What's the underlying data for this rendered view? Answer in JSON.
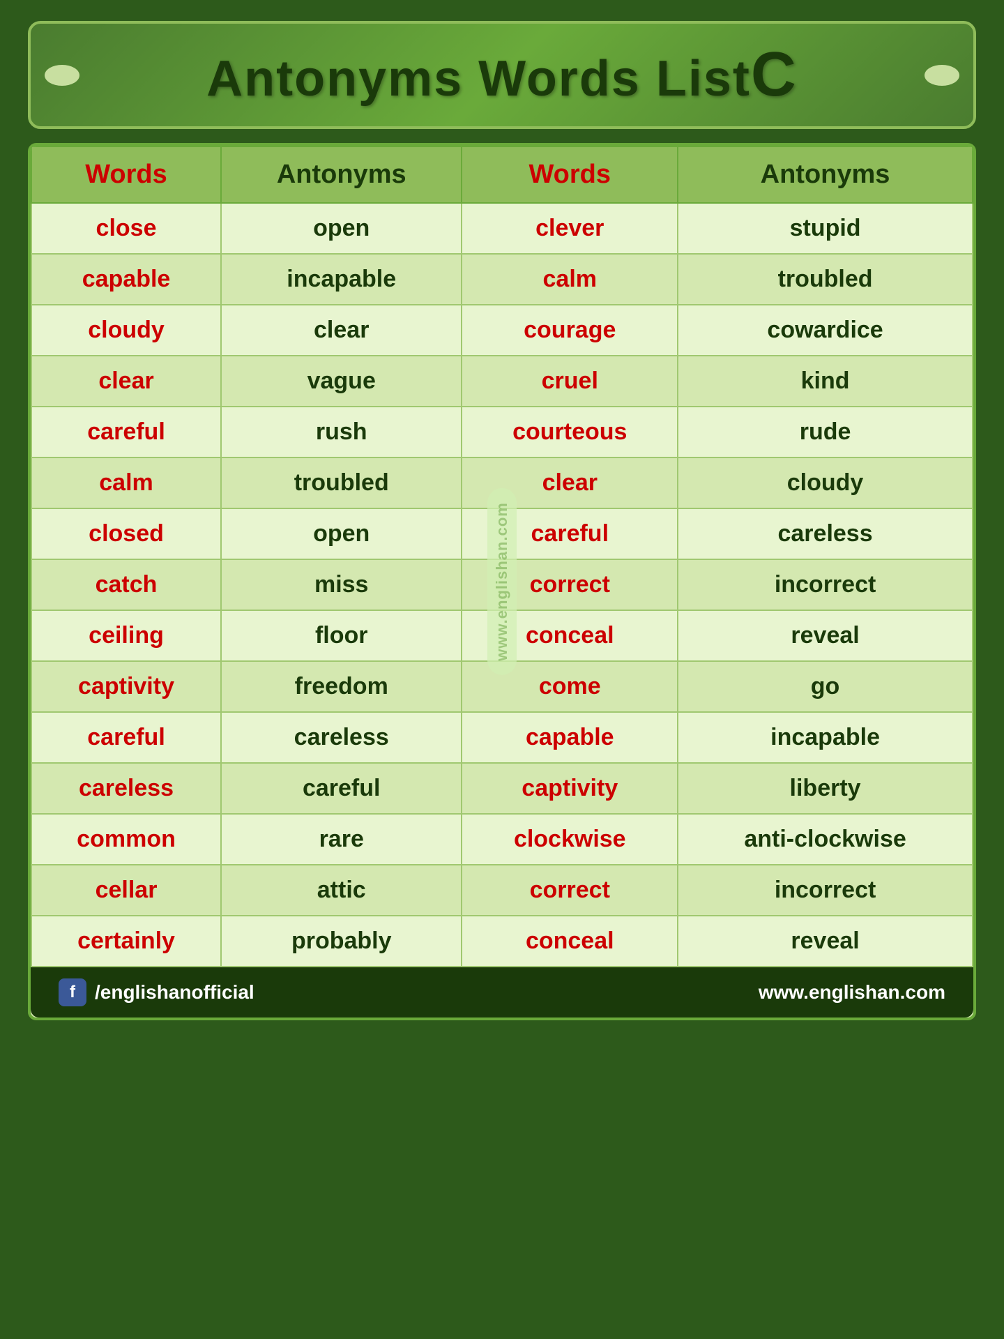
{
  "header": {
    "title": "Antonyms Words  List",
    "letter": "C"
  },
  "table": {
    "columns": [
      "Words",
      "Antonyms",
      "Words",
      "Antonyms"
    ],
    "rows": [
      {
        "word1": "close",
        "ant1": "open",
        "word2": "clever",
        "ant2": "stupid"
      },
      {
        "word1": "capable",
        "ant1": "incapable",
        "word2": "calm",
        "ant2": "troubled"
      },
      {
        "word1": "cloudy",
        "ant1": "clear",
        "word2": "courage",
        "ant2": "cowardice"
      },
      {
        "word1": "clear",
        "ant1": "vague",
        "word2": "cruel",
        "ant2": "kind"
      },
      {
        "word1": "careful",
        "ant1": "rush",
        "word2": "courteous",
        "ant2": "rude"
      },
      {
        "word1": "calm",
        "ant1": "troubled",
        "word2": "clear",
        "ant2": "cloudy"
      },
      {
        "word1": "closed",
        "ant1": "open",
        "word2": "careful",
        "ant2": "careless"
      },
      {
        "word1": "catch",
        "ant1": "miss",
        "word2": "correct",
        "ant2": "incorrect"
      },
      {
        "word1": "ceiling",
        "ant1": "floor",
        "word2": "conceal",
        "ant2": "reveal"
      },
      {
        "word1": "captivity",
        "ant1": "freedom",
        "word2": "come",
        "ant2": "go"
      },
      {
        "word1": "careful",
        "ant1": "careless",
        "word2": "capable",
        "ant2": "incapable"
      },
      {
        "word1": "careless",
        "ant1": "careful",
        "word2": "captivity",
        "ant2": "liberty"
      },
      {
        "word1": "common",
        "ant1": "rare",
        "word2": "clockwise",
        "ant2": "anti-clockwise"
      },
      {
        "word1": "cellar",
        "ant1": "attic",
        "word2": "correct",
        "ant2": "incorrect"
      },
      {
        "word1": "certainly",
        "ant1": "probably",
        "word2": "conceal",
        "ant2": "reveal"
      }
    ]
  },
  "watermark": "www.englishan.com",
  "footer": {
    "social": "/englishanofficial",
    "website": "www.englishan.com"
  }
}
